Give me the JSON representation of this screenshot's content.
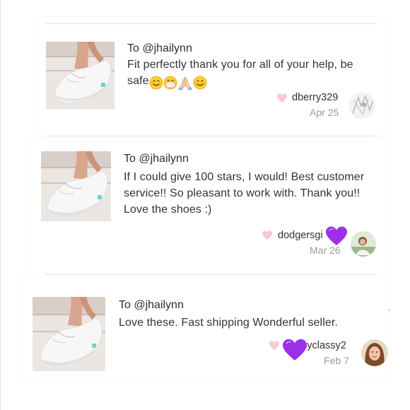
{
  "reviews": [
    {
      "to": "To @jhailynn",
      "message": "Fit perfectly thank you for all of your help, be safe",
      "emojis": [
        "smiling-face",
        "face-with-medical-mask",
        "folded-hands",
        "smiling-face"
      ],
      "username": "dberry329",
      "date": "Apr 25"
    },
    {
      "to": "To @jhailynn",
      "message": "If I could give 100 stars, I would! Best customer service!! So pleasant to work with. Thank you!! Love the shoes :)",
      "username": "dodgersgi",
      "date": "Mar 26"
    },
    {
      "to": "To @jhailynn",
      "message": "Love these. Fast shipping Wonderful seller.",
      "username": "syclassy2",
      "date": "Feb 7"
    }
  ],
  "colors": {
    "heart": "#f7c9d2",
    "purple_heart": "#9b30e8",
    "text": "#333333",
    "muted": "#9a9a9a"
  }
}
